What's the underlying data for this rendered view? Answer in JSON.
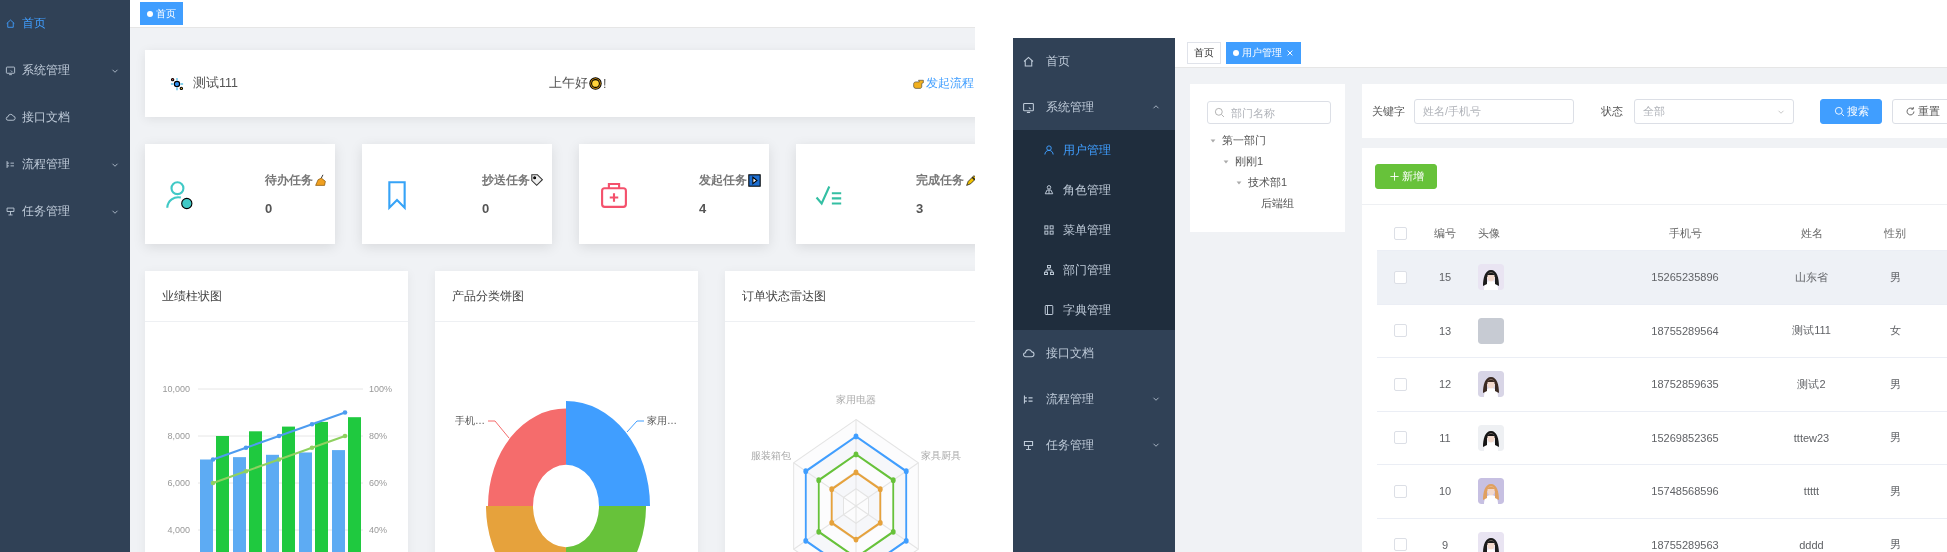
{
  "dashboard": {
    "sidebar": {
      "items": [
        {
          "label": "首页",
          "selected": true
        },
        {
          "label": "系统管理",
          "selected": false,
          "expanded": false
        },
        {
          "label": "接口文档",
          "selected": false
        },
        {
          "label": "流程管理",
          "selected": false,
          "expanded": false
        },
        {
          "label": "任务管理",
          "selected": false,
          "expanded": false
        }
      ]
    },
    "tabs": [
      {
        "label": "首页",
        "selected": true
      }
    ],
    "welcome": {
      "user": "测试111",
      "greeting": "上午好",
      "greeting_end": "!",
      "link": "发起流程"
    },
    "stats": [
      {
        "kind": "pending",
        "label": "待办任务",
        "value": "0",
        "color": "#40c9c6"
      },
      {
        "kind": "copied",
        "label": "抄送任务",
        "value": "0",
        "color": "#36a3f7"
      },
      {
        "kind": "started",
        "label": "发起任务",
        "value": "4",
        "color": "#f4516c"
      },
      {
        "kind": "done",
        "label": "完成任务",
        "value": "3",
        "color": "#34bfa3"
      }
    ],
    "bar_panel": {
      "title": "业绩柱状图",
      "chart_data": {
        "type": "bar",
        "grid": true,
        "ylim": [
          0,
          10000
        ],
        "y2lim": [
          0,
          1
        ],
        "yticks": [
          {
            "value": 4000,
            "label": "4,000"
          },
          {
            "value": 6000,
            "label": "6,000"
          },
          {
            "value": 8000,
            "label": "8,000"
          },
          {
            "value": 10000,
            "label": "10,000"
          }
        ],
        "y2ticks": [
          {
            "value": 0.4,
            "label": "40%"
          },
          {
            "value": 0.6,
            "label": "60%"
          },
          {
            "value": 0.8,
            "label": "80%"
          },
          {
            "value": 1,
            "label": "100%"
          }
        ],
        "series": [
          {
            "color": "#5dabf3",
            "values": [
              7000,
              7100,
              7200,
              7300,
              7400
            ]
          },
          {
            "color": "#1fc93f",
            "values": [
              8000,
              8200,
              8400,
              8600,
              8800
            ]
          },
          {
            "type": "line",
            "axis": "y2",
            "color": "#4d9cf0",
            "values": [
              0.7,
              0.75,
              0.8,
              0.85,
              0.9
            ]
          },
          {
            "type": "line",
            "axis": "y2",
            "color": "#8fd160",
            "values": [
              0.6,
              0.65,
              0.7,
              0.75,
              0.8
            ]
          }
        ]
      }
    },
    "pie_panel": {
      "title": "产品分类饼图",
      "labels": [
        "手机…",
        "家用…"
      ]
    },
    "radar_panel": {
      "title": "订单状态雷达图",
      "axis_labels": [
        "家用电器",
        "服装箱包",
        "家具厨具"
      ]
    }
  },
  "user_management": {
    "sidebar": {
      "items": [
        {
          "label": "首页",
          "selected": false
        },
        {
          "label": "系统管理",
          "selected": false,
          "expanded": true,
          "children": [
            {
              "label": "用户管理",
              "selected": true
            },
            {
              "label": "角色管理",
              "selected": false
            },
            {
              "label": "菜单管理",
              "selected": false
            },
            {
              "label": "部门管理",
              "selected": false
            },
            {
              "label": "字典管理",
              "selected": false
            }
          ]
        },
        {
          "label": "接口文档",
          "selected": false
        },
        {
          "label": "流程管理",
          "selected": false,
          "expanded": false
        },
        {
          "label": "任务管理",
          "selected": false,
          "expanded": false
        }
      ]
    },
    "tabs": [
      {
        "label": "首页",
        "selected": false,
        "closable": false
      },
      {
        "label": "用户管理",
        "selected": true,
        "closable": true
      }
    ],
    "department_tree": {
      "search": {
        "placeholder": "部门名称"
      },
      "nodes": [
        {
          "label": "第一部门",
          "expanded": true,
          "children": [
            {
              "label": "刚刚1",
              "expanded": true,
              "children": [
                {
                  "label": "技术部1",
                  "expanded": true,
                  "children": [
                    {
                      "label": "后端组"
                    }
                  ]
                }
              ]
            }
          ]
        }
      ]
    },
    "filters": {
      "keyword_label": "关键字",
      "keyword": {
        "placeholder": "姓名/手机号"
      },
      "status_label": "状态",
      "status": {
        "placeholder": "全部"
      },
      "buttons": [
        {
          "kind": "search",
          "label": "搜索"
        },
        {
          "kind": "reset",
          "label": "重置"
        }
      ]
    },
    "add_button": "新增",
    "table": {
      "columns": [
        "编号",
        "头像",
        "手机号",
        "姓名",
        "性别"
      ],
      "header_checked": false,
      "rows": [
        {
          "checked": false,
          "highlighted": true,
          "id": "15",
          "phone": "15265235896",
          "name": "山东省",
          "gender": "男"
        },
        {
          "checked": false,
          "highlighted": false,
          "id": "13",
          "avatar": {
            "kind": "placeholder"
          },
          "phone": "18755289564",
          "name": "测试111",
          "gender": "女"
        },
        {
          "checked": false,
          "highlighted": false,
          "id": "12",
          "phone": "18752859635",
          "name": "测试2",
          "gender": "男"
        },
        {
          "checked": false,
          "highlighted": false,
          "id": "11",
          "phone": "15269852365",
          "name": "tttew23",
          "gender": "男"
        },
        {
          "checked": false,
          "highlighted": false,
          "id": "10",
          "phone": "15748568596",
          "name": "ttttt",
          "gender": "男"
        },
        {
          "checked": false,
          "highlighted": false,
          "id": "9",
          "phone": "18755289563",
          "name": "dddd",
          "gender": "男"
        }
      ]
    }
  }
}
